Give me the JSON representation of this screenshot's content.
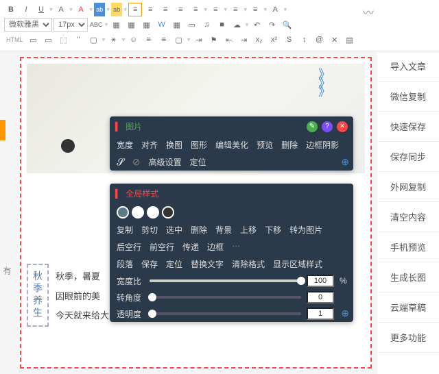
{
  "toolbar": {
    "font_family": "微软雅黑",
    "font_size": "17px",
    "html_label": "HTML",
    "abc_label": "ABC"
  },
  "sidebar_left_char": "有",
  "arrows": "》\n》\n》",
  "vertical_label": "秋季养生",
  "body_lines": [
    "秋季，暑夏",
    "因眼前的美",
    "今天就来给大家介绍一些秋季养生的食谱与饮食忌讳"
  ],
  "panel_img": {
    "title": "图片",
    "row1": [
      "宽度",
      "对齐",
      "换图",
      "图形",
      "编辑美化",
      "预览",
      "删除",
      "边框阴影"
    ],
    "row2_icons": [
      "link-icon",
      "unlink-icon"
    ],
    "row2": [
      "高级设置",
      "定位"
    ]
  },
  "panel_region": {
    "title": "全局样式",
    "row1": [
      "复制",
      "剪切",
      "选中",
      "删除",
      "背景",
      "上移",
      "下移",
      "转为图片"
    ],
    "row2": [
      "后空行",
      "前空行",
      "传递",
      "边框"
    ],
    "row3": [
      "段落",
      "保存",
      "定位",
      "替换文字",
      "清除格式",
      "显示区域样式"
    ],
    "sliders": [
      {
        "label": "宽度比",
        "value": "100",
        "unit": "%",
        "pct": 100
      },
      {
        "label": "转角度",
        "value": "0",
        "unit": "",
        "pct": 2
      },
      {
        "label": "透明度",
        "value": "1",
        "unit": "",
        "pct": 2
      }
    ]
  },
  "right_menu": [
    "导入文章",
    "微信复制",
    "快速保存",
    "保存同步",
    "外网复制",
    "清空内容",
    "手机预览",
    "生成长图",
    "云端草稿",
    "更多功能"
  ]
}
